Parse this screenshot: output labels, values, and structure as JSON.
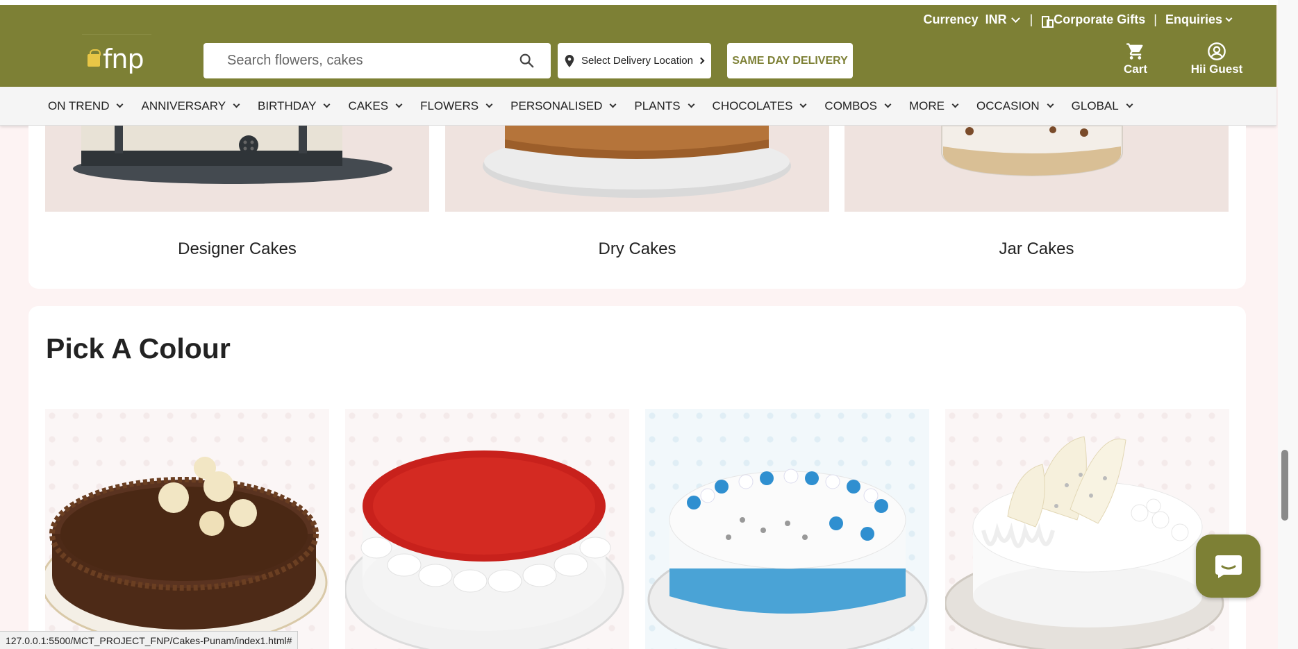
{
  "topbar": {
    "currency_label": "Currency",
    "currency_value": "INR",
    "separator": "|",
    "corporate_gifts": "Corporate Gifts",
    "enquiries": "Enquiries"
  },
  "header": {
    "logo_text": "fnp",
    "search_placeholder": "Search flowers, cakes",
    "location_label": "Select Delivery Location",
    "same_day_label": "SAME DAY DELIVERY",
    "cart_label": "Cart",
    "guest_label": "Hii Guest"
  },
  "menu": [
    {
      "label": "ON TREND"
    },
    {
      "label": "ANNIVERSARY"
    },
    {
      "label": "BIRTHDAY"
    },
    {
      "label": "CAKES"
    },
    {
      "label": "FLOWERS"
    },
    {
      "label": "PERSONALISED"
    },
    {
      "label": "PLANTS"
    },
    {
      "label": "CHOCOLATES"
    },
    {
      "label": "COMBOS"
    },
    {
      "label": "MORE"
    },
    {
      "label": "OCCASION"
    },
    {
      "label": "GLOBAL"
    }
  ],
  "categories": [
    {
      "label": "Designer Cakes"
    },
    {
      "label": "Dry Cakes"
    },
    {
      "label": "Jar Cakes"
    }
  ],
  "pick_colour": {
    "title": "Pick A Colour"
  },
  "status_url": "127.0.0.1:5500/MCT_PROJECT_FNP/Cakes-Punam/index1.html#",
  "colors": {
    "brand": "#7d8035",
    "page_bg": "#fdf3f3"
  }
}
